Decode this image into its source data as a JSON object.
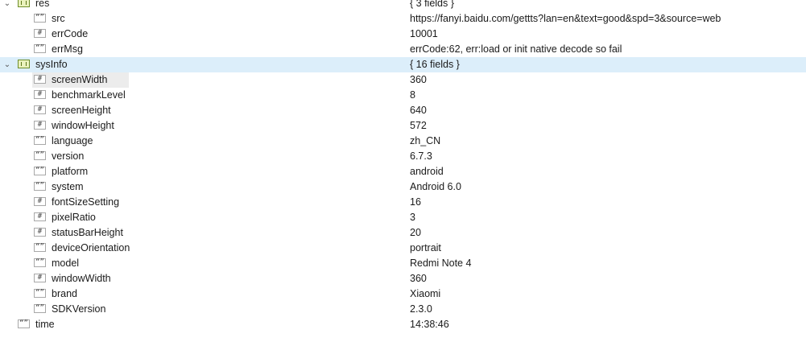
{
  "tree": [
    {
      "key": "res",
      "value": "{ 3 fields }",
      "type": "object",
      "level": 0,
      "expanded": true,
      "selected": false,
      "highlighted": false
    },
    {
      "key": "src",
      "value": "https://fanyi.baidu.com/gettts?lan=en&text=good&spd=3&source=web",
      "type": "string",
      "level": 1,
      "selected": false,
      "highlighted": false
    },
    {
      "key": "errCode",
      "value": "10001",
      "type": "number",
      "level": 1,
      "selected": false,
      "highlighted": false
    },
    {
      "key": "errMsg",
      "value": "errCode:62, err:load or init native decode so fail",
      "type": "string",
      "level": 1,
      "selected": false,
      "highlighted": false
    },
    {
      "key": "sysInfo",
      "value": "{ 16 fields }",
      "type": "object",
      "level": 0,
      "expanded": true,
      "selected": true,
      "highlighted": false
    },
    {
      "key": "screenWidth",
      "value": "360",
      "type": "number",
      "level": 1,
      "selected": false,
      "highlighted": true
    },
    {
      "key": "benchmarkLevel",
      "value": "8",
      "type": "number",
      "level": 1,
      "selected": false,
      "highlighted": false
    },
    {
      "key": "screenHeight",
      "value": "640",
      "type": "number",
      "level": 1,
      "selected": false,
      "highlighted": false
    },
    {
      "key": "windowHeight",
      "value": "572",
      "type": "number",
      "level": 1,
      "selected": false,
      "highlighted": false
    },
    {
      "key": "language",
      "value": "zh_CN",
      "type": "string",
      "level": 1,
      "selected": false,
      "highlighted": false
    },
    {
      "key": "version",
      "value": "6.7.3",
      "type": "string",
      "level": 1,
      "selected": false,
      "highlighted": false
    },
    {
      "key": "platform",
      "value": "android",
      "type": "string",
      "level": 1,
      "selected": false,
      "highlighted": false
    },
    {
      "key": "system",
      "value": "Android 6.0",
      "type": "string",
      "level": 1,
      "selected": false,
      "highlighted": false
    },
    {
      "key": "fontSizeSetting",
      "value": "16",
      "type": "number",
      "level": 1,
      "selected": false,
      "highlighted": false
    },
    {
      "key": "pixelRatio",
      "value": "3",
      "type": "number",
      "level": 1,
      "selected": false,
      "highlighted": false
    },
    {
      "key": "statusBarHeight",
      "value": "20",
      "type": "number",
      "level": 1,
      "selected": false,
      "highlighted": false
    },
    {
      "key": "deviceOrientation",
      "value": "portrait",
      "type": "string",
      "level": 1,
      "selected": false,
      "highlighted": false
    },
    {
      "key": "model",
      "value": "Redmi Note 4",
      "type": "string",
      "level": 1,
      "selected": false,
      "highlighted": false
    },
    {
      "key": "windowWidth",
      "value": "360",
      "type": "number",
      "level": 1,
      "selected": false,
      "highlighted": false
    },
    {
      "key": "brand",
      "value": "Xiaomi",
      "type": "string",
      "level": 1,
      "selected": false,
      "highlighted": false
    },
    {
      "key": "SDKVersion",
      "value": "2.3.0",
      "type": "string",
      "level": 1,
      "selected": false,
      "highlighted": false
    },
    {
      "key": "time",
      "value": "14:38:46",
      "type": "string",
      "level": 0,
      "selected": false,
      "highlighted": false
    }
  ],
  "icons": {
    "object": "object-icon",
    "string": "string-icon",
    "number": "number-icon",
    "expanded": "chevron-down-icon"
  },
  "colors": {
    "selected_row": "#dceefa",
    "highlight_cell": "#ececec",
    "object_icon": "#eaf2bd"
  }
}
